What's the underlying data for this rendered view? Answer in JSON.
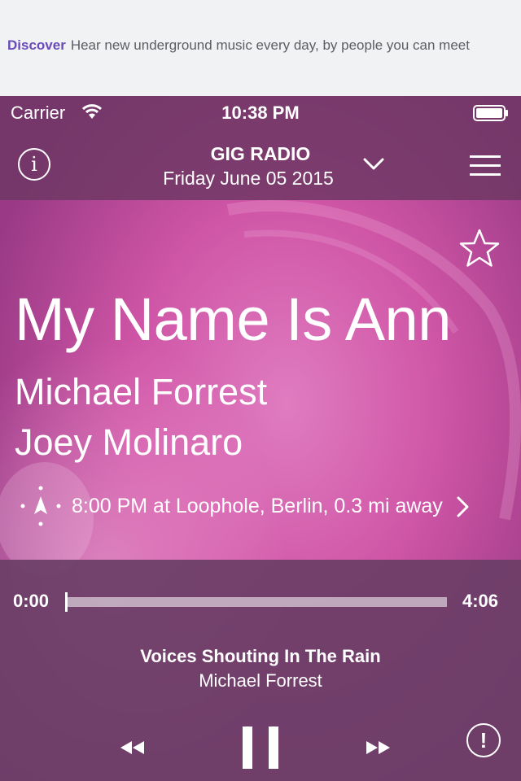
{
  "banner": {
    "label": "Discover",
    "text": "Hear new underground music every day, by people you can meet"
  },
  "status_bar": {
    "carrier": "Carrier",
    "time": "10:38 PM",
    "icons": [
      "wifi-icon",
      "battery-icon"
    ]
  },
  "header": {
    "info_icon": "info-icon",
    "info_label": "i",
    "title": "GIG RADIO",
    "date": "Friday June 05 2015",
    "dropdown_icon": "chevron-down-icon",
    "menu_icon": "menu-icon"
  },
  "now_playing": {
    "favorite_icon": "star-icon",
    "title": "My Name Is Ann",
    "artists": [
      "Michael Forrest",
      "Joey Molinaro"
    ],
    "event": "8:00 PM at Loophole, Berlin, 0.3 mi away",
    "event_icon": "location-icon",
    "event_chevron": "chevron-right-icon"
  },
  "player": {
    "time_current": "0:00",
    "time_total": "4:06",
    "progress_fraction": 0,
    "track_title": "Voices Shouting In The Rain",
    "track_artist": "Michael Forrest",
    "controls": {
      "rewind_icon": "rewind-icon",
      "pause_icon": "pause-icon",
      "forward_icon": "fast-forward-icon",
      "report_icon": "exclamation-icon",
      "report_label": "!"
    }
  },
  "colors": {
    "banner_accent": "#6a4bb7",
    "overlay": "#6e3764",
    "art_pink": "#d05aa8"
  }
}
